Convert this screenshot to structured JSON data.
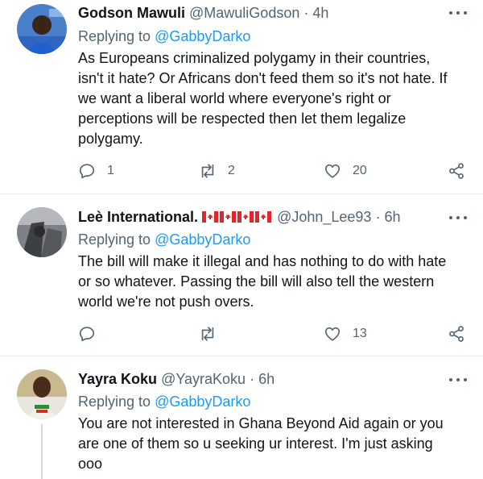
{
  "tweets": [
    {
      "name": "Godson Mawuli",
      "handle": "@MawuliGodson",
      "time": "4h",
      "replying_label": "Replying to",
      "replying_to": "@GabbyDarko",
      "text_lines": [
        "As Europeans criminalized polygamy in their countries,",
        "isn't it hate? Or Africans don't feed them so it's not hate. If",
        "we want a liberal world where everyone's right or",
        "perceptions will be respected then let them legalize",
        "polygamy."
      ],
      "replies": "1",
      "retweets": "2",
      "likes": "20"
    },
    {
      "name": "Leè International.",
      "flags": [
        "canada-flag",
        "canada-flag",
        "canada-flag",
        "canada-flag"
      ],
      "handle": "@John_Lee93",
      "time": "6h",
      "replying_label": "Replying to",
      "replying_to": "@GabbyDarko",
      "text_lines": [
        "The bill will make it illegal and has nothing to do with hate",
        "or so whatever. Passing the bill will also tell the western",
        "world we're not push overs."
      ],
      "replies": "",
      "retweets": "",
      "likes": "13"
    },
    {
      "name": "Yayra Koku",
      "handle": "@YayraKoku",
      "time": "6h",
      "replying_label": "Replying to",
      "replying_to": "@GabbyDarko",
      "text_lines": [
        "You are not interested in Ghana Beyond Aid again or you",
        "are one of them so u seeking ur interest. I'm just asking",
        "ooo"
      ]
    }
  ],
  "separator": "·",
  "icons": {
    "reply": "reply-icon",
    "retweet": "retweet-icon",
    "like": "heart-icon",
    "share": "share-icon",
    "more": "more-icon"
  },
  "colors": {
    "text": "#0f1419",
    "secondary": "#536471",
    "link": "#1d9bf0",
    "divider": "#e6ecf0"
  }
}
